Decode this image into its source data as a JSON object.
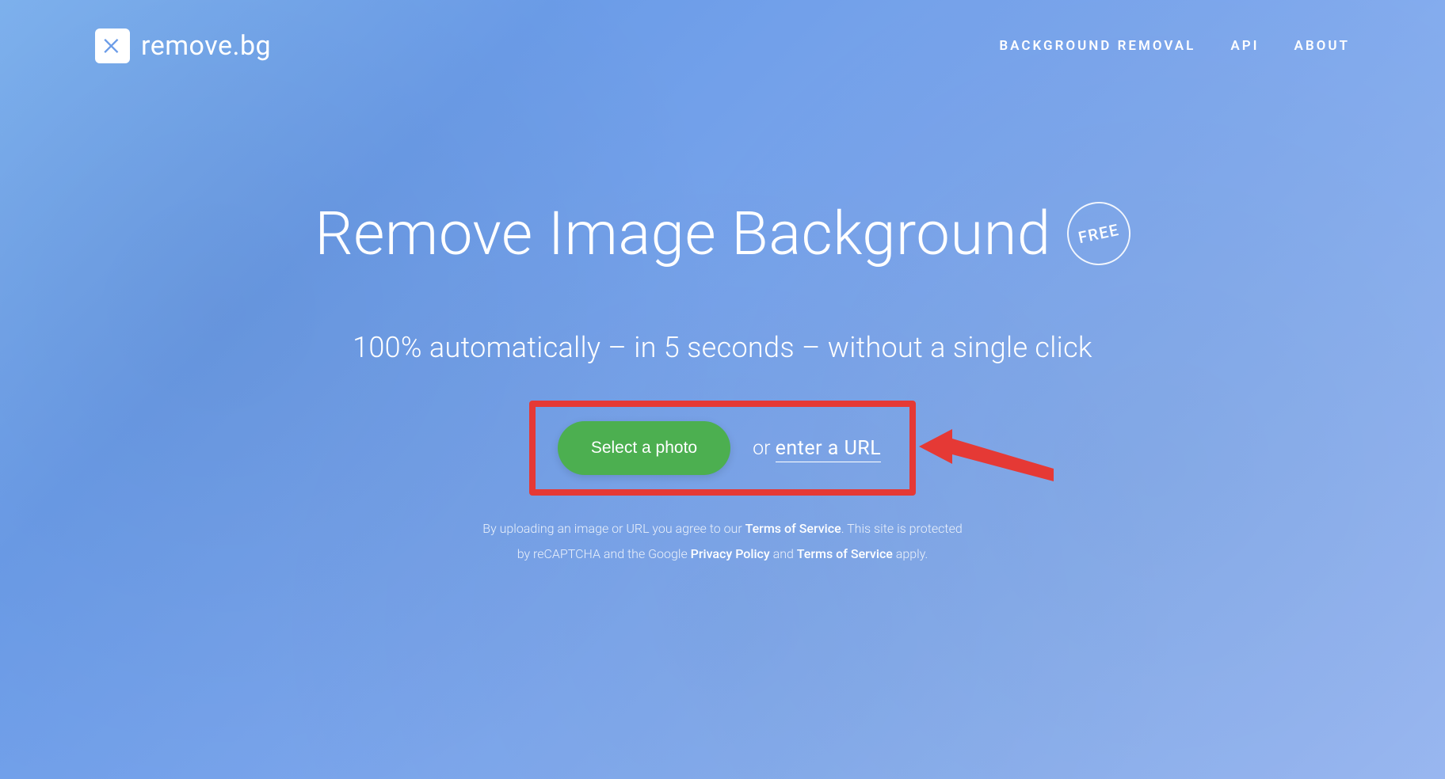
{
  "brand": {
    "name": "remove.bg"
  },
  "nav": {
    "bg_removal": "BACKGROUND REMOVAL",
    "api": "API",
    "about": "ABOUT"
  },
  "hero": {
    "title": "Remove Image Background",
    "badge": "FREE",
    "subtitle": "100% automatically – in 5 seconds – without a single click"
  },
  "cta": {
    "select_label": "Select a photo",
    "or_text": "or ",
    "url_link": "enter a URL"
  },
  "legal": {
    "line1_a": "By uploading an image or URL you agree to our ",
    "tos1": "Terms of Service",
    "line1_b": ". This site is protected",
    "line2_a": "by reCAPTCHA and the Google ",
    "privacy": "Privacy Policy",
    "and": " and ",
    "tos2": "Terms of Service",
    "apply": " apply."
  },
  "annotation": {
    "highlight_color": "#e53935"
  }
}
